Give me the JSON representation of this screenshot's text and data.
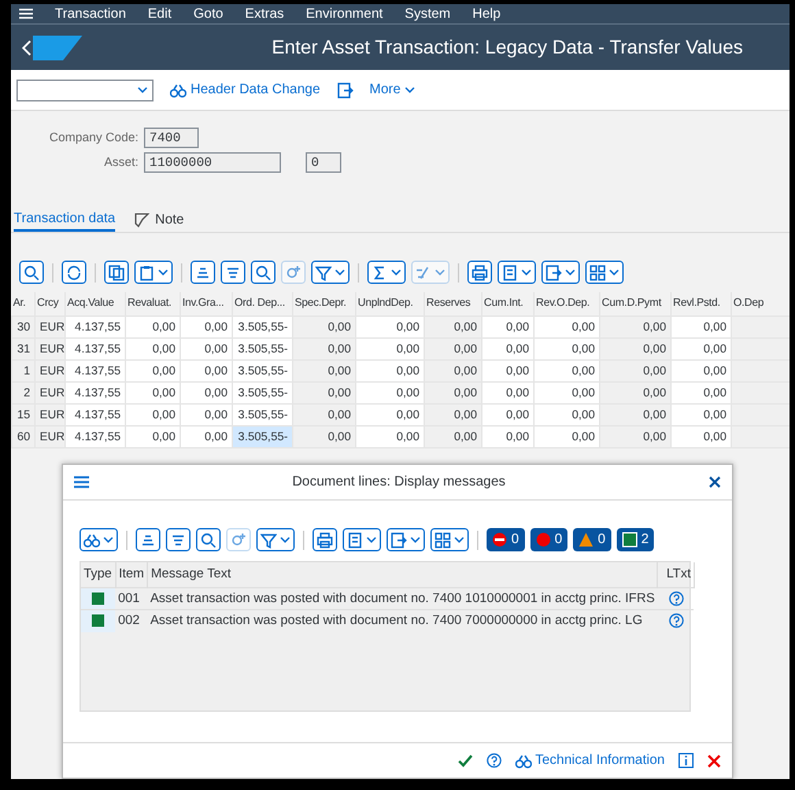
{
  "menu": [
    "Transaction",
    "Edit",
    "Goto",
    "Extras",
    "Environment",
    "System",
    "Help"
  ],
  "title": "Enter Asset Transaction: Legacy Data - Transfer Values",
  "toolbar": {
    "header_button": "Header Data Change",
    "more_button": "More"
  },
  "header_fields": [
    {
      "label": "Company Code:",
      "value": "7400"
    },
    {
      "label": "Asset:",
      "value": "11000000",
      "sub_value": "0"
    }
  ],
  "tabs": [
    {
      "label": "Transaction data",
      "selected": true
    },
    {
      "label": "Note",
      "selected": false
    }
  ],
  "table": {
    "columns": [
      {
        "label": "Ar.",
        "editable": false
      },
      {
        "label": "Crcy",
        "editable": false
      },
      {
        "label": "Acq.Value",
        "editable": true
      },
      {
        "label": "Revaluat.",
        "editable": true
      },
      {
        "label": "Inv.Gra...",
        "editable": true
      },
      {
        "label": "Ord. Dep...",
        "editable": true
      },
      {
        "label": "Spec.Depr.",
        "editable": false
      },
      {
        "label": "UnplndDep.",
        "editable": true
      },
      {
        "label": "Reserves",
        "editable": false
      },
      {
        "label": "Cum.Int.",
        "editable": true
      },
      {
        "label": "Rev.O.Dep.",
        "editable": true
      },
      {
        "label": "Cum.D.Pymt",
        "editable": false
      },
      {
        "label": "Revl.Pstd.",
        "editable": true
      },
      {
        "label": "O.Dep",
        "editable": false
      }
    ],
    "rows": [
      {
        "cells": [
          {
            "text": "30",
            "selected": false
          },
          {
            "text": "EUR",
            "selected": false
          },
          {
            "text": "4.137,55",
            "selected": false
          },
          {
            "text": "0,00",
            "selected": false
          },
          {
            "text": "0,00",
            "selected": false
          },
          {
            "text": "3.505,55-",
            "selected": false
          },
          {
            "text": "0,00",
            "selected": false
          },
          {
            "text": "0,00",
            "selected": false
          },
          {
            "text": "0,00",
            "selected": false
          },
          {
            "text": "0,00",
            "selected": false
          },
          {
            "text": "0,00",
            "selected": false
          },
          {
            "text": "0,00",
            "selected": false
          },
          {
            "text": "0,00",
            "selected": false
          }
        ]
      },
      {
        "cells": [
          {
            "text": "31",
            "selected": false
          },
          {
            "text": "EUR",
            "selected": false
          },
          {
            "text": "4.137,55",
            "selected": false
          },
          {
            "text": "0,00",
            "selected": false
          },
          {
            "text": "0,00",
            "selected": false
          },
          {
            "text": "3.505,55-",
            "selected": false
          },
          {
            "text": "0,00",
            "selected": false
          },
          {
            "text": "0,00",
            "selected": false
          },
          {
            "text": "0,00",
            "selected": false
          },
          {
            "text": "0,00",
            "selected": false
          },
          {
            "text": "0,00",
            "selected": false
          },
          {
            "text": "0,00",
            "selected": false
          },
          {
            "text": "0,00",
            "selected": false
          }
        ]
      },
      {
        "cells": [
          {
            "text": "1",
            "selected": false
          },
          {
            "text": "EUR",
            "selected": false
          },
          {
            "text": "4.137,55",
            "selected": false
          },
          {
            "text": "0,00",
            "selected": false
          },
          {
            "text": "0,00",
            "selected": false
          },
          {
            "text": "3.505,55-",
            "selected": false
          },
          {
            "text": "0,00",
            "selected": false
          },
          {
            "text": "0,00",
            "selected": false
          },
          {
            "text": "0,00",
            "selected": false
          },
          {
            "text": "0,00",
            "selected": false
          },
          {
            "text": "0,00",
            "selected": false
          },
          {
            "text": "0,00",
            "selected": false
          },
          {
            "text": "0,00",
            "selected": false
          }
        ]
      },
      {
        "cells": [
          {
            "text": "2",
            "selected": false
          },
          {
            "text": "EUR",
            "selected": false
          },
          {
            "text": "4.137,55",
            "selected": false
          },
          {
            "text": "0,00",
            "selected": false
          },
          {
            "text": "0,00",
            "selected": false
          },
          {
            "text": "3.505,55-",
            "selected": false
          },
          {
            "text": "0,00",
            "selected": false
          },
          {
            "text": "0,00",
            "selected": false
          },
          {
            "text": "0,00",
            "selected": false
          },
          {
            "text": "0,00",
            "selected": false
          },
          {
            "text": "0,00",
            "selected": false
          },
          {
            "text": "0,00",
            "selected": false
          },
          {
            "text": "0,00",
            "selected": false
          }
        ]
      },
      {
        "cells": [
          {
            "text": "15",
            "selected": false
          },
          {
            "text": "EUR",
            "selected": false
          },
          {
            "text": "4.137,55",
            "selected": false
          },
          {
            "text": "0,00",
            "selected": false
          },
          {
            "text": "0,00",
            "selected": false
          },
          {
            "text": "3.505,55-",
            "selected": false
          },
          {
            "text": "0,00",
            "selected": false
          },
          {
            "text": "0,00",
            "selected": false
          },
          {
            "text": "0,00",
            "selected": false
          },
          {
            "text": "0,00",
            "selected": false
          },
          {
            "text": "0,00",
            "selected": false
          },
          {
            "text": "0,00",
            "selected": false
          },
          {
            "text": "0,00",
            "selected": false
          }
        ]
      },
      {
        "cells": [
          {
            "text": "60",
            "selected": false
          },
          {
            "text": "EUR",
            "selected": false
          },
          {
            "text": "4.137,55",
            "selected": false
          },
          {
            "text": "0,00",
            "selected": false
          },
          {
            "text": "0,00",
            "selected": false
          },
          {
            "text": "3.505,55-",
            "selected": true
          },
          {
            "text": "0,00",
            "selected": false
          },
          {
            "text": "0,00",
            "selected": false
          },
          {
            "text": "0,00",
            "selected": false
          },
          {
            "text": "0,00",
            "selected": false
          },
          {
            "text": "0,00",
            "selected": false
          },
          {
            "text": "0,00",
            "selected": false
          },
          {
            "text": "0,00",
            "selected": false
          }
        ]
      }
    ]
  },
  "dialog": {
    "title": "Document lines: Display messages",
    "counters": [
      {
        "kind": "stop",
        "count": "0"
      },
      {
        "kind": "error",
        "count": "0"
      },
      {
        "kind": "warning",
        "count": "0"
      },
      {
        "kind": "success",
        "count": "2"
      }
    ],
    "columns": [
      "Type",
      "Item",
      "Message Text",
      "LTxt"
    ],
    "messages": [
      {
        "kind": "success",
        "item": "001",
        "text": "Asset transaction was posted with document no. 7400 1010000001 in acctg princ. IFRS"
      },
      {
        "kind": "success",
        "item": "002",
        "text": "Asset transaction was posted with document no. 7400 7000000000 in acctg princ. LG"
      }
    ],
    "technical_button": "Technical Information"
  }
}
